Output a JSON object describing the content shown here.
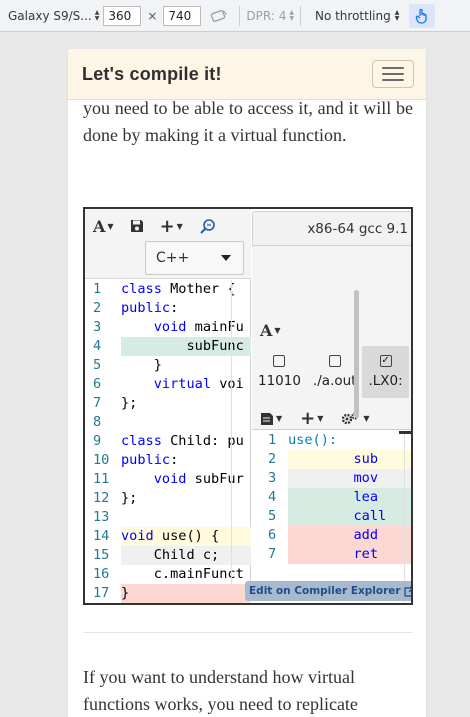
{
  "devtools": {
    "device": "Galaxy S9/S...",
    "width": "360",
    "height": "740",
    "times": "×",
    "dpr": "DPR: 4",
    "throttling": "No throttling"
  },
  "navbar": {
    "brand": "Let's compile it!"
  },
  "article": {
    "intro": "you need to be able to access it, and it will be done by making it a virtual function.",
    "outro": "If you want to understand how virtual functions works, you need to replicate"
  },
  "compiler_explorer": {
    "language": "C++",
    "compiler_tab": "x86-64 gcc 9.1",
    "filters": [
      {
        "label": "11010",
        "checked": false
      },
      {
        "label": "./a.out",
        "checked": false
      },
      {
        "label": ".LX0:",
        "checked": true
      }
    ],
    "source_lines": [
      {
        "n": "1",
        "text": "class Mother {",
        "hl": ""
      },
      {
        "n": "2",
        "text": "public:",
        "hl": ""
      },
      {
        "n": "3",
        "text": "    void mainFu",
        "hl": ""
      },
      {
        "n": "4",
        "text": "        subFunc",
        "hl": "green"
      },
      {
        "n": "5",
        "text": "    }",
        "hl": ""
      },
      {
        "n": "6",
        "text": "    virtual voi",
        "hl": ""
      },
      {
        "n": "7",
        "text": "};",
        "hl": ""
      },
      {
        "n": "8",
        "text": "",
        "hl": ""
      },
      {
        "n": "9",
        "text": "class Child: pu",
        "hl": ""
      },
      {
        "n": "10",
        "text": "public:",
        "hl": ""
      },
      {
        "n": "11",
        "text": "    void subFur",
        "hl": ""
      },
      {
        "n": "12",
        "text": "};",
        "hl": ""
      },
      {
        "n": "13",
        "text": "",
        "hl": ""
      },
      {
        "n": "14",
        "text": "void use() {",
        "hl": "yellow"
      },
      {
        "n": "15",
        "text": "    Child c;",
        "hl": "gray"
      },
      {
        "n": "16",
        "text": "    c.mainFunct",
        "hl": ""
      },
      {
        "n": "17",
        "text": "}",
        "hl": "red"
      }
    ],
    "asm_lines": [
      {
        "n": "1",
        "text": "use():",
        "hl": "",
        "label": true
      },
      {
        "n": "2",
        "text": "        sub",
        "hl": "yellow",
        "label": false
      },
      {
        "n": "3",
        "text": "        mov",
        "hl": "gray",
        "label": false
      },
      {
        "n": "4",
        "text": "        lea",
        "hl": "green",
        "label": false
      },
      {
        "n": "5",
        "text": "        call",
        "hl": "green",
        "label": false
      },
      {
        "n": "6",
        "text": "        add",
        "hl": "red",
        "label": false
      },
      {
        "n": "7",
        "text": "        ret",
        "hl": "red",
        "label": false
      }
    ],
    "edit_link": "Edit on Compiler Explorer"
  }
}
